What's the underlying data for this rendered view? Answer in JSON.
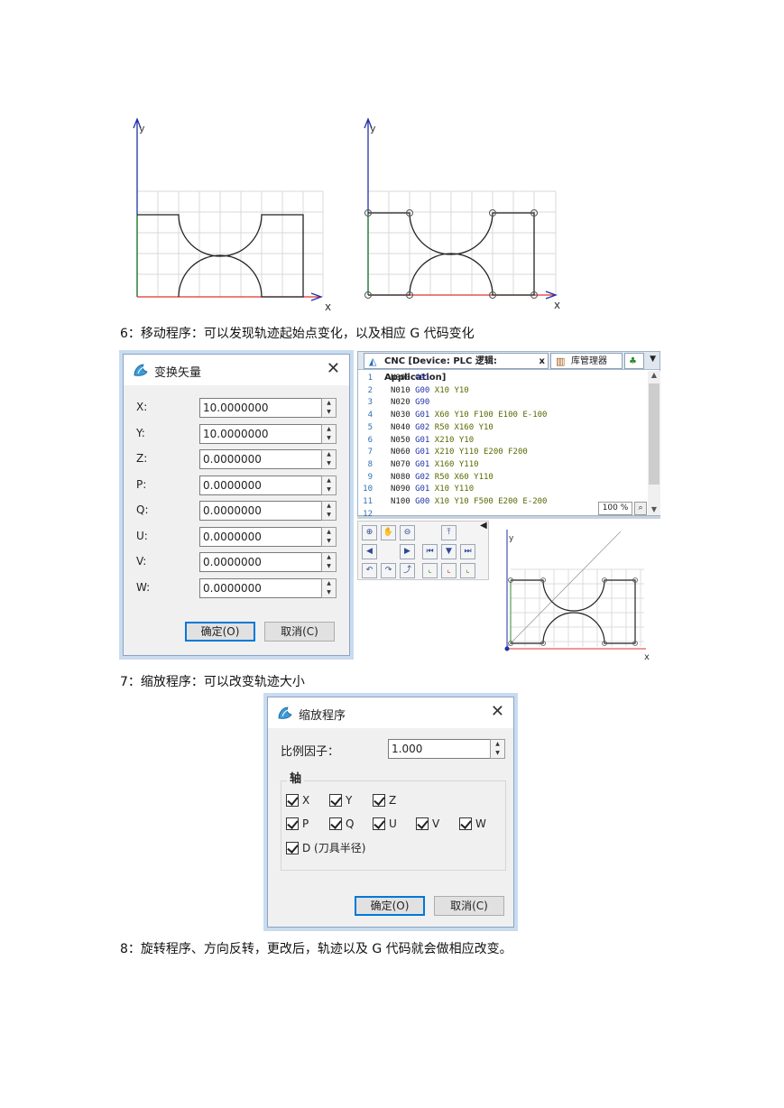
{
  "figure1": {
    "y_label": "y",
    "x_label": "x"
  },
  "figure2": {
    "y_label": "y",
    "x_label": "x"
  },
  "captions": {
    "c6": "6：移动程序：可以发现轨迹起始点变化，以及相应 G 代码变化",
    "c7": "7：缩放程序：可以改变轨迹大小",
    "c8": "8：旋转程序、方向反转，更改后，轨迹以及 G 代码就会做相应改变。"
  },
  "transform_dialog": {
    "title": "变换矢量",
    "fields": [
      {
        "label": "X:",
        "value": "10.0000000"
      },
      {
        "label": "Y:",
        "value": "10.0000000"
      },
      {
        "label": "Z:",
        "value": "0.0000000"
      },
      {
        "label": "P:",
        "value": "0.0000000"
      },
      {
        "label": "Q:",
        "value": "0.0000000"
      },
      {
        "label": "U:",
        "value": "0.0000000"
      },
      {
        "label": "V:",
        "value": "0.0000000"
      },
      {
        "label": "W:",
        "value": "0.0000000"
      }
    ],
    "ok": "确定(O)",
    "cancel": "取消(C)"
  },
  "editor": {
    "tab_cnc": "CNC [Device: PLC 逻辑: Application]",
    "tab_lib": "库管理器",
    "zoom": "100 %",
    "lines": [
      {
        "n": "1",
        "code": "N000 G91"
      },
      {
        "n": "2",
        "code": "N010 G00 X10 Y10"
      },
      {
        "n": "3",
        "code": "N020 G90"
      },
      {
        "n": "4",
        "code": "N030 G01 X60 Y10 F100 E100 E-100"
      },
      {
        "n": "5",
        "code": "N040 G02 R50 X160 Y10"
      },
      {
        "n": "6",
        "code": "N050 G01 X210 Y10"
      },
      {
        "n": "7",
        "code": "N060 G01 X210 Y110 E200 F200"
      },
      {
        "n": "8",
        "code": "N070 G01 X160 Y110"
      },
      {
        "n": "9",
        "code": "N080 G02 R50 X60 Y110"
      },
      {
        "n": "10",
        "code": "N090 G01 X10 Y110"
      },
      {
        "n": "11",
        "code": "N100 G00 X10 Y10 F500 E200 E-200"
      },
      {
        "n": "12",
        "code": ""
      }
    ],
    "view_y": "y",
    "view_x": "x"
  },
  "scale_dialog": {
    "title": "缩放程序",
    "factor_label": "比例因子：",
    "factor_value": "1.000",
    "axis_group": "轴",
    "axes_row1": [
      "X",
      "Y",
      "Z"
    ],
    "axes_row2": [
      "P",
      "Q",
      "U",
      "V",
      "W"
    ],
    "axis_d": "D (刀具半径)",
    "ok": "确定(O)",
    "cancel": "取消(C)"
  },
  "colors": {
    "axis_y": "#1f2fa8",
    "axis_x": "#e03030",
    "axis_y_green": "#2e8b2e",
    "grid": "#d8d8d8",
    "path": "#222222"
  }
}
